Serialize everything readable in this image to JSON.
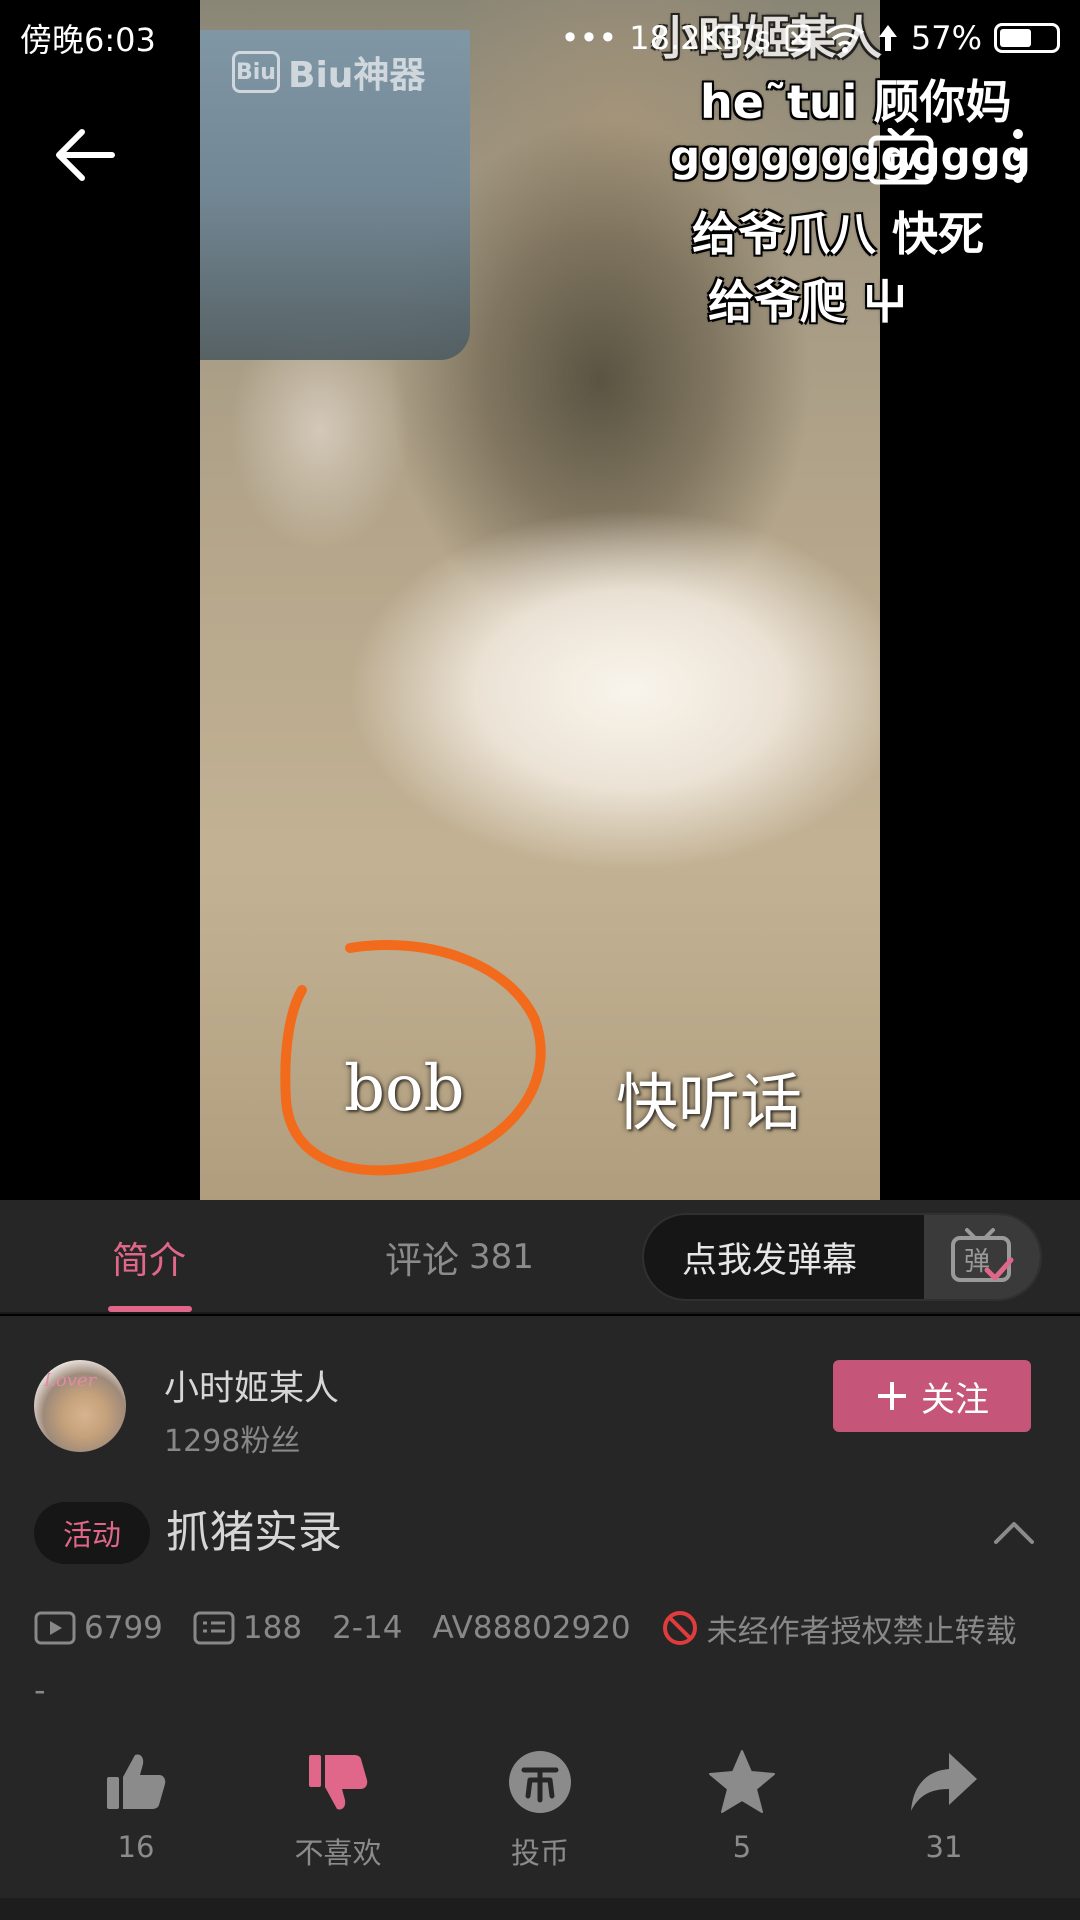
{
  "status_bar": {
    "time": "傍晚6:03",
    "network_speed": "18.2KB/s",
    "battery": "57%"
  },
  "video": {
    "watermark": "Biu神器",
    "danmaku": [
      "小时姬某人",
      "he˜tui 顾你妈",
      "gggggggggggg",
      "给爷爪八 快死",
      "给爷爬 屮"
    ],
    "subtitles": [
      "bob",
      "快听话"
    ]
  },
  "tabs": {
    "intro": "简介",
    "comments": "评论",
    "comment_count": "381"
  },
  "danmu_input": {
    "placeholder": "点我发弹幕",
    "icon_label": "弹"
  },
  "uploader": {
    "name": "小时姬某人",
    "fans": "1298粉丝",
    "avatar_text": "Lover",
    "follow_label": "关注"
  },
  "video_info": {
    "tag": "活动",
    "title": "抓猪实录",
    "views": "6799",
    "danmaku_count": "188",
    "date": "2-14",
    "av_id": "AV88802920",
    "copyright": "未经作者授权禁止转载",
    "description": "-"
  },
  "actions": {
    "like": "16",
    "dislike": "不喜欢",
    "coin": "投币",
    "favorite": "5",
    "share": "31"
  },
  "colors": {
    "accent": "#e0678a",
    "follow_bg": "#c5567a",
    "panel_bg": "#262626",
    "annotation": "#f26b1d"
  }
}
